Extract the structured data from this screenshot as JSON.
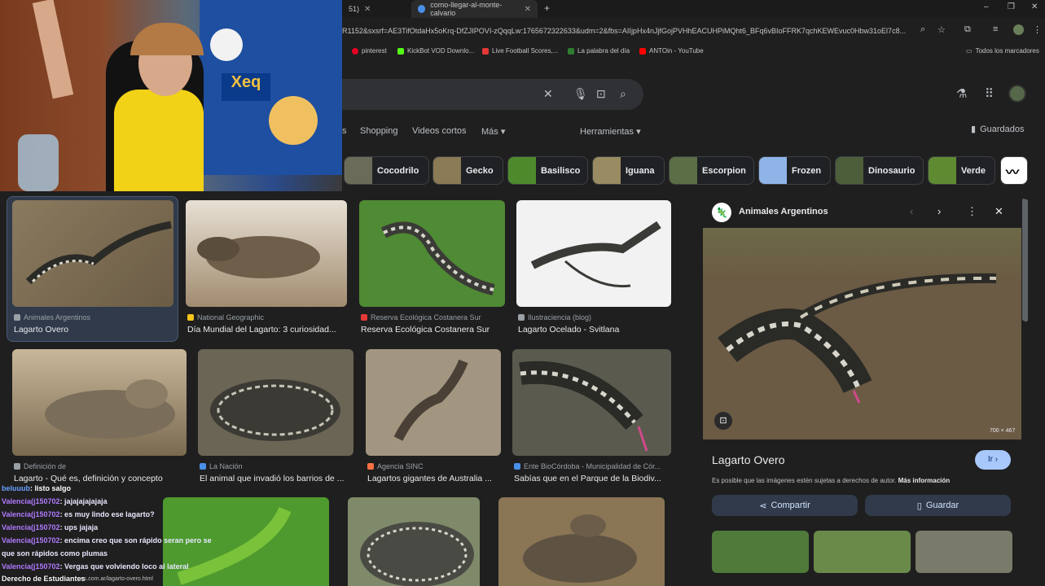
{
  "browser": {
    "tabs": [
      {
        "label": "51)",
        "close": "✕"
      },
      {
        "label": "como-llegar-al-monte-calvario",
        "close": "✕"
      }
    ],
    "new_tab": "+",
    "window_controls": [
      "–",
      "❐",
      "✕"
    ],
    "address": "R1152&sxsrf=AE3TifOtdaHx5oKrq-DfZJIPOVI-zQqqLw:1765672322633&udm=2&fbs=AIIjpHx4nJjfGojPVHhEACUHPiMQht6_BFq6vBIoFFRK7qchKEWEvuc0Hbw31oEl7c8..."
  },
  "bookmarks": [
    {
      "label": "pinterest",
      "color": "#e60023"
    },
    {
      "label": "KickBot VOD Downlo...",
      "color": "#53fc18"
    },
    {
      "label": "Live Football Scores,...",
      "color": "#e53935"
    },
    {
      "label": "La palabra del día",
      "color": "#2e7d32"
    },
    {
      "label": "ANTOin - YouTube",
      "color": "#ff0000"
    }
  ],
  "bookmarks_all": "Todos los marcadores",
  "nav_tabs": [
    {
      "label": "s"
    },
    {
      "label": "Shopping"
    },
    {
      "label": "Videos cortos"
    },
    {
      "label": "Más ▾"
    },
    {
      "label": "Herramientas ▾"
    }
  ],
  "saved": "Guardados",
  "chips": [
    {
      "label": "Cocodrilo",
      "color": "#6b6b5a"
    },
    {
      "label": "Gecko",
      "color": "#8a7a55"
    },
    {
      "label": "Basilisco",
      "color": "#4e8a2c"
    },
    {
      "label": "Iguana",
      "color": "#9a8c62"
    },
    {
      "label": "Escorpion",
      "color": "#5b6e45"
    },
    {
      "label": "Frozen",
      "color": "#8fb4e8"
    },
    {
      "label": "Dinosaurio",
      "color": "#4d5e3a"
    },
    {
      "label": "Verde",
      "color": "#5f8a32"
    }
  ],
  "results": [
    {
      "source": "Animales Argentinos",
      "title": "Lagarto Overo",
      "color": "#7a6b55"
    },
    {
      "source": "National Geographic",
      "title": "Día Mundial del Lagarto: 3 curiosidad...",
      "color": "#8a7560"
    },
    {
      "source": "Reserva Ecológica Costanera Sur",
      "title": "Reserva Ecológica Costanera Sur",
      "color": "#4f8a34"
    },
    {
      "source": "Ilustraciencia (blog)",
      "title": "Lagarto Ocelado - Svitlana",
      "color": "#f2f2f2"
    },
    {
      "source": "Definición de",
      "title": "Lagarto - Qué es, definición y concepto",
      "color": "#8a7a5a"
    },
    {
      "source": "La Nación",
      "title": "El animal que invadió los barrios de ...",
      "color": "#6b6555"
    },
    {
      "source": "Agencia SINC",
      "title": "Lagartos gigantes de Australia ...",
      "color": "#a39680"
    },
    {
      "source": "Ente BioCórdoba - Municipalidad de Cór...",
      "title": "Sabías que en el Parque de la Biodiv...",
      "color": "#5a5a4e"
    },
    {
      "source": "",
      "title": "",
      "color": "#4e9a2e"
    },
    {
      "source": "",
      "title": "",
      "color": "#7f8a6a"
    },
    {
      "source": "",
      "title": "",
      "color": "#8a7555"
    }
  ],
  "panel": {
    "source": "Animales Argentinos",
    "title": "Lagarto Overo",
    "go": "Ir ›",
    "size": "700 × 467",
    "notice": "Es posible que las imágenes estén sujetas a derechos de autor.",
    "more_info": "Más información",
    "share": "Compartir",
    "save": "Guardar"
  },
  "chat": [
    {
      "user": "beluuub",
      "text": ": listo salgo"
    },
    {
      "user": "Valencia(j150702",
      "text": ": jajajajajajaja"
    },
    {
      "user": "Valencia(j150702",
      "text": ": es muy lindo ese lagarto?"
    },
    {
      "user": "Valencia(j150702",
      "text": ": ups jajaja"
    },
    {
      "user": "Valencia(j150702",
      "text": ": encima creo que son rápido seran pero se"
    },
    {
      "user": "",
      "text": "que son rápidos como plumas"
    },
    {
      "user": "Valencia(j150702",
      "text": ": Vergas que volviendo loco al lateral"
    }
  ],
  "status_url": "nos.com.ar/lagarto-overo.html",
  "overlay_text": "Derecho de Estudiantes",
  "webcam": {
    "shirt_logo": "Xeq"
  }
}
